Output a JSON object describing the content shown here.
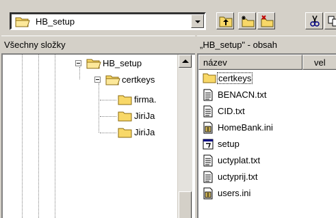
{
  "toolbar": {
    "address": "HB_setup",
    "buttons": [
      {
        "name": "up-folder-button",
        "icon": "up-folder-icon"
      },
      {
        "name": "new-folder-button",
        "icon": "new-folder-icon"
      },
      {
        "name": "delete-button",
        "icon": "delete-icon"
      },
      {
        "name": "cut-button",
        "icon": "scissors-icon"
      },
      {
        "name": "copy-button",
        "icon": "copy-icon"
      }
    ]
  },
  "left_pane": {
    "header": "Všechny složky",
    "tree": [
      {
        "label": "HB_setup",
        "icon": "folder-open-icon"
      },
      {
        "label": "certkeys",
        "icon": "folder-open-icon"
      },
      {
        "label": "firma.",
        "icon": "folder-icon"
      },
      {
        "label": "JiriJa",
        "icon": "folder-icon"
      },
      {
        "label": "JiriJa",
        "icon": "folder-icon"
      }
    ]
  },
  "right_pane": {
    "header": "„HB_setup\" - obsah",
    "columns": [
      "název",
      "vel"
    ],
    "files": [
      {
        "name": "certkeys",
        "icon": "folder-icon",
        "selected": true
      },
      {
        "name": "BENACN.txt",
        "icon": "text-file-icon"
      },
      {
        "name": "CID.txt",
        "icon": "text-file-icon"
      },
      {
        "name": "HomeBank.ini",
        "icon": "ini-file-icon"
      },
      {
        "name": "setup",
        "icon": "setup-file-icon"
      },
      {
        "name": "uctyplat.txt",
        "icon": "text-file-icon"
      },
      {
        "name": "uctyprij.txt",
        "icon": "text-file-icon"
      },
      {
        "name": "users.ini",
        "icon": "ini-file-icon"
      }
    ]
  },
  "colors": {
    "chrome": "#d4d0c8",
    "folder_yellow": "#f8d868",
    "window_bg": "#ffffff"
  }
}
